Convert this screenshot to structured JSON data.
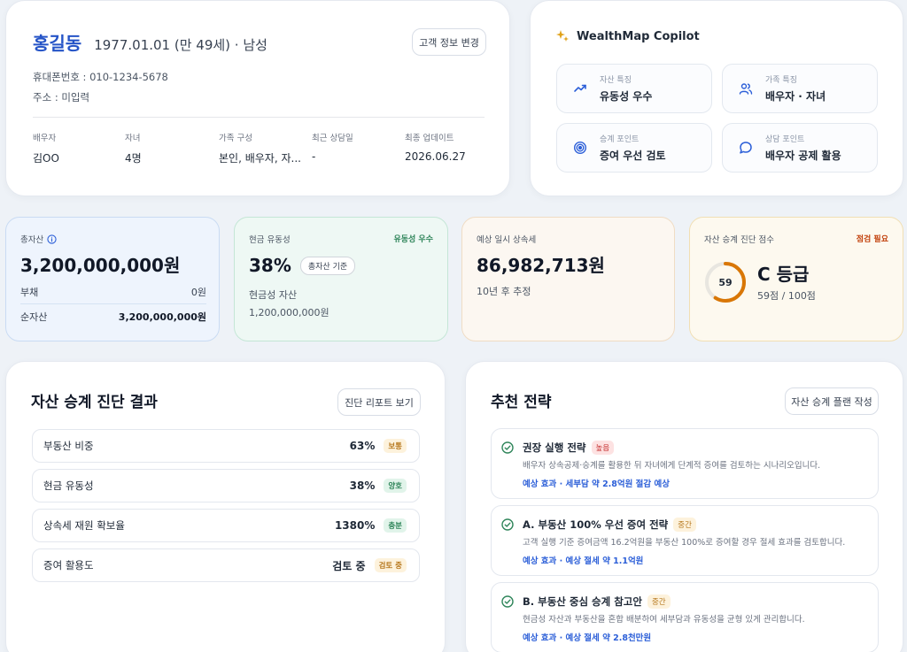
{
  "profile": {
    "name": "홍길동",
    "birth": "1977.01.01 (만 49세) · 남성",
    "edit_button": "고객 정보 변경",
    "phone": "휴대폰번호 : 010-1234-5678",
    "address": "주소 : 미입력",
    "fields": [
      {
        "label": "배우자",
        "value": "김OO"
      },
      {
        "label": "자녀",
        "value": "4명"
      },
      {
        "label": "가족 구성",
        "value": "본인, 배우자, 자..."
      },
      {
        "label": "최근 상담일",
        "value": "-"
      },
      {
        "label": "최종 업데이트",
        "value": "2026.06.27"
      }
    ]
  },
  "copilot": {
    "title": "WealthMap Copilot",
    "tiles": [
      {
        "label": "자산 특징",
        "value": "유동성 우수",
        "icon": "trend-up-icon"
      },
      {
        "label": "가족 특징",
        "value": "배우자 · 자녀",
        "icon": "users-icon"
      },
      {
        "label": "승계 포인트",
        "value": "증여 우선 검토",
        "icon": "target-icon"
      },
      {
        "label": "상담 포인트",
        "value": "배우자 공제 활용",
        "icon": "chat-icon"
      }
    ]
  },
  "metrics": {
    "assets": {
      "label": "총자산",
      "value": "3,200,000,000원",
      "debt_label": "부채",
      "debt_value": "0원",
      "net_label": "순자산",
      "net_value": "3,200,000,000원"
    },
    "cash": {
      "label": "현금 유동성",
      "badge": "유동성 우수",
      "value": "38%",
      "pill": "총자산 기준",
      "sub_label": "현금성 자산",
      "sub_value": "1,200,000,000원"
    },
    "tax": {
      "label": "예상 일시 상속세",
      "value": "86,982,713원",
      "sub": "10년 후 추정"
    },
    "score": {
      "label": "자산 승계 진단 점수",
      "badge": "점검 필요",
      "score": "59",
      "score_fraction": 0.59,
      "grade": "C 등급",
      "detail": "59점 / 100점"
    }
  },
  "diagnosis": {
    "title": "자산 승계 진단 결과",
    "report_button": "진단 리포트 보기",
    "rows": [
      {
        "name": "부동산 비중",
        "value": "63%",
        "tag": "보통",
        "tag_type": "warn"
      },
      {
        "name": "현금 유동성",
        "value": "38%",
        "tag": "양호",
        "tag_type": "good"
      },
      {
        "name": "상속세 재원 확보율",
        "value": "1380%",
        "tag": "충분",
        "tag_type": "good"
      },
      {
        "name": "증여 활용도",
        "value": "검토 중",
        "tag": "검토 중",
        "tag_type": "warn"
      }
    ]
  },
  "strategy": {
    "title": "추천 전략",
    "plan_button": "자산 승계 플랜 작성",
    "items": [
      {
        "title": "권장 실행 전략",
        "tag": "높음",
        "tag_type": "hi",
        "desc": "배우자 상속공제·승계를 활용한 뒤 자녀에게 단계적 증여를 검토하는 시나리오입니다.",
        "effect": "예상 효과 · 세부담 약 2.8억원 절감 예상"
      },
      {
        "title": "A. 부동산 100% 우선 증여 전략",
        "tag": "중간",
        "tag_type": "warn",
        "desc": "고객 실행 기준 증여금액 16.2억원을 부동산 100%로 증여할 경우 절세 효과를 검토합니다.",
        "effect": "예상 효과 · 예상 절세 약 1.1억원"
      },
      {
        "title": "B. 부동산 중심 승계 참고안",
        "tag": "중간",
        "tag_type": "warn",
        "desc": "현금성 자산과 부동산을 혼합 배분하여 세부담과 유동성을 균형 있게 관리합니다.",
        "effect": "예상 효과 · 예상 절세 약 2.8천만원"
      }
    ]
  },
  "colors": {
    "accent": "#2554c7",
    "good": "#2f855a",
    "warn": "#b7791f",
    "danger": "#c53030",
    "gauge": "#d97706"
  }
}
